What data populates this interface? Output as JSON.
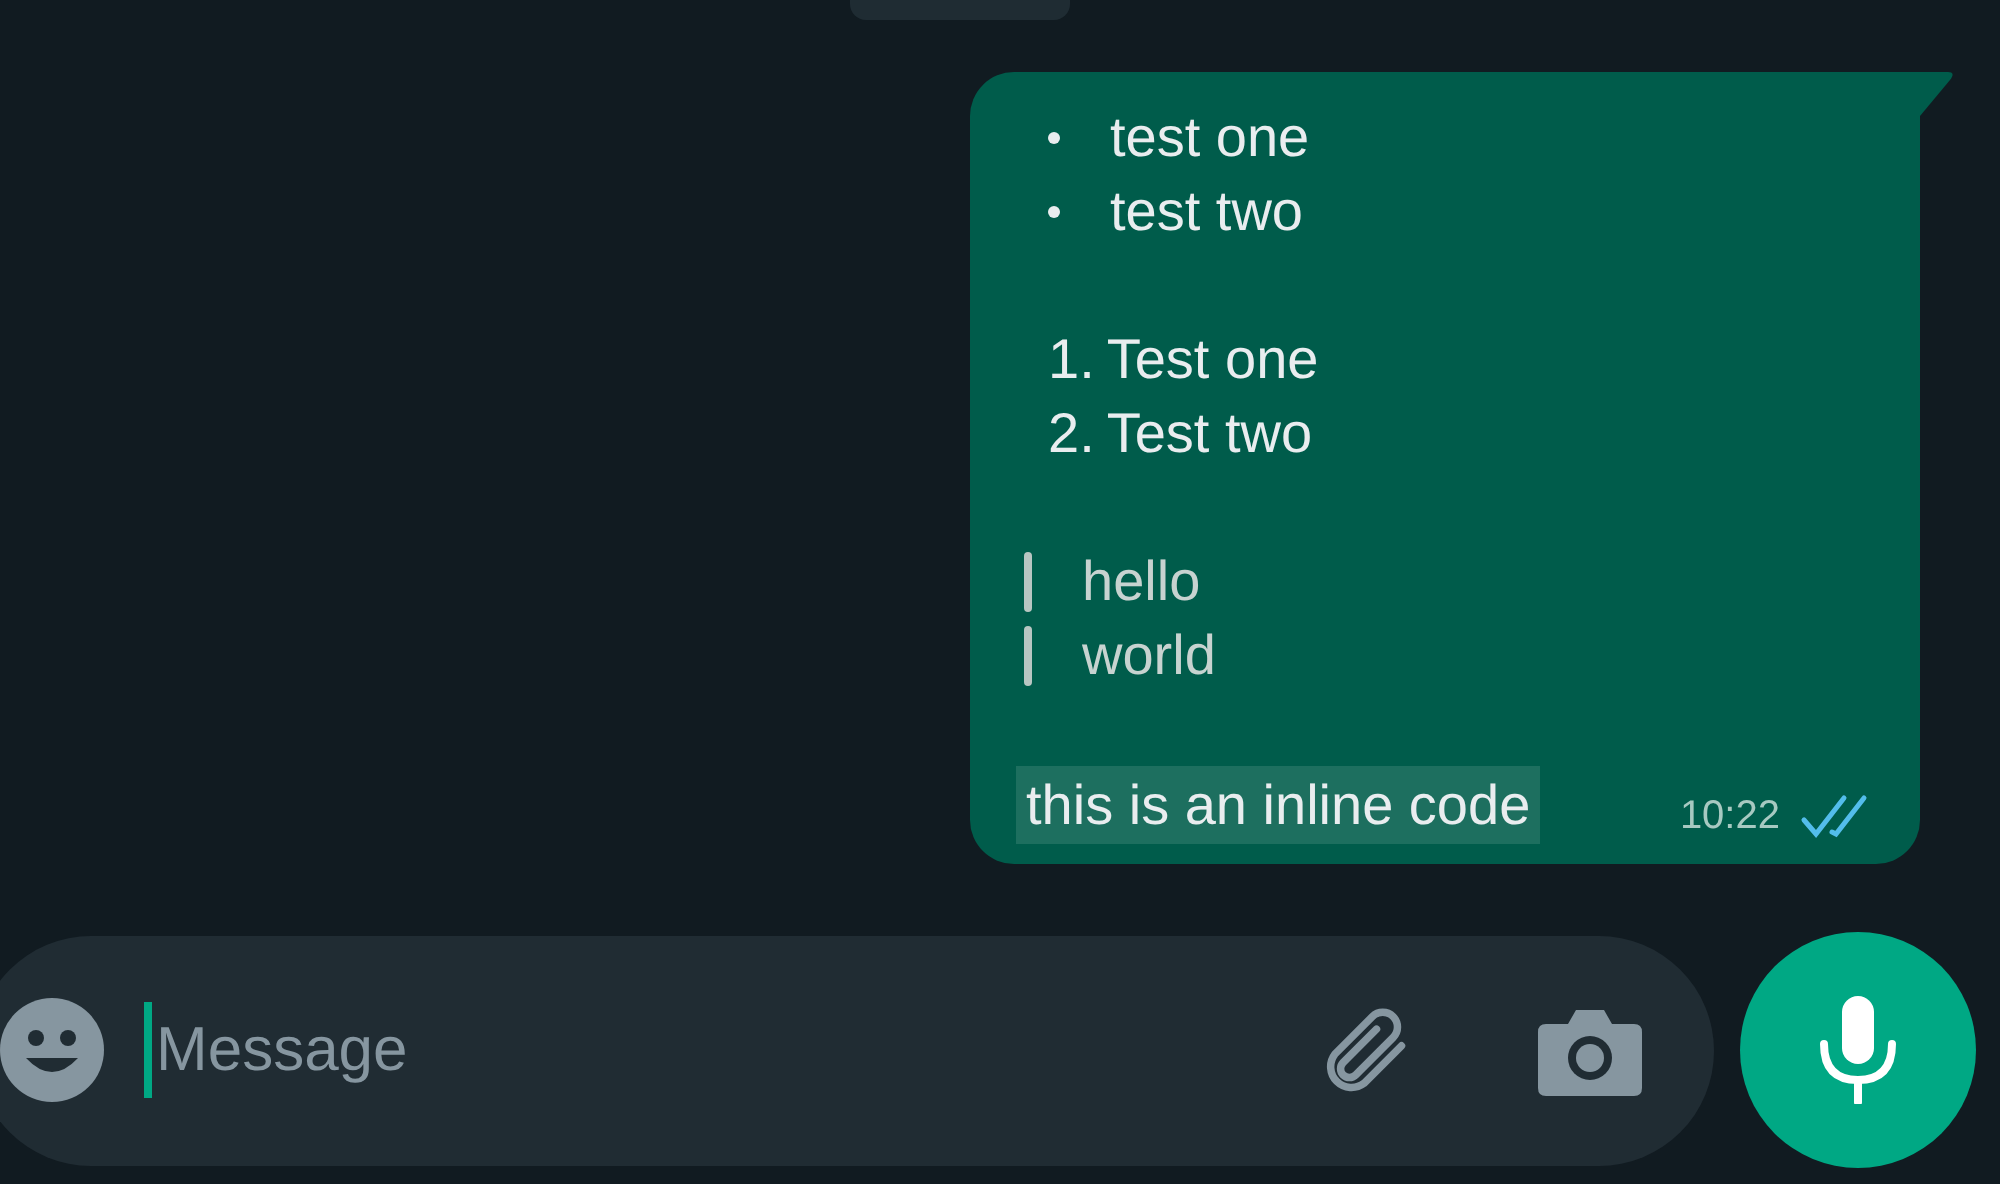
{
  "message": {
    "blocks": [
      {
        "kind": "bullet_list",
        "items": [
          "test one",
          "test two"
        ]
      },
      {
        "kind": "numbered_list",
        "items": [
          {
            "number": "1.",
            "text": "Test one"
          },
          {
            "number": "2.",
            "text": "Test two"
          }
        ]
      },
      {
        "kind": "quote",
        "lines": [
          "hello",
          "world"
        ]
      },
      {
        "kind": "code",
        "text": "this is an inline code"
      }
    ],
    "time": "10:22",
    "read": true
  },
  "composer": {
    "placeholder": "Message"
  }
}
